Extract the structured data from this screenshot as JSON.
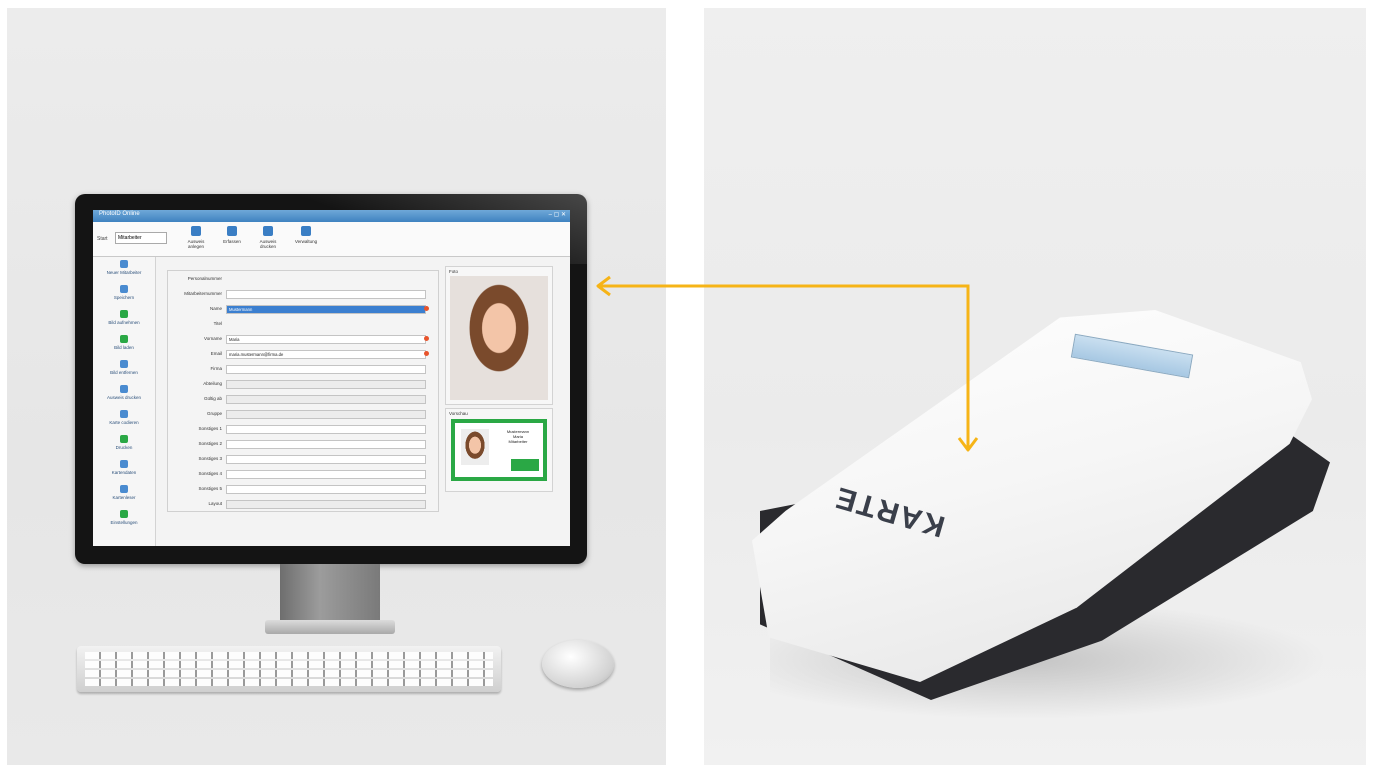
{
  "app": {
    "window_title": "PhotoID Online",
    "window_buttons": "– ▢ ✕",
    "ribbon": {
      "start_label": "Start",
      "dropdown_value": "Mitarbeiter",
      "buttons": [
        {
          "label": "Ausweis anlegen",
          "icon": "person-add-icon"
        },
        {
          "label": "Erfassen",
          "icon": "id-card-icon"
        },
        {
          "label": "Ausweis drucken",
          "icon": "print-icon"
        },
        {
          "label": "Verwaltung",
          "icon": "settings-icon"
        }
      ]
    },
    "sidebar": [
      {
        "label": "Neuer Mitarbeiter",
        "icon": "user-add-icon"
      },
      {
        "label": "Speichern",
        "icon": "save-icon"
      },
      {
        "label": "Bild aufnehmen",
        "icon": "camera-icon"
      },
      {
        "label": "Bild laden",
        "icon": "image-icon"
      },
      {
        "label": "Bild entfernen",
        "icon": "image-remove-icon"
      },
      {
        "label": "Ausweis drucken",
        "icon": "print-icon"
      },
      {
        "label": "Karte codieren",
        "icon": "card-icon"
      },
      {
        "label": "Drucken",
        "icon": "printer-icon"
      },
      {
        "label": "Kartendaten",
        "icon": "card-data-icon"
      },
      {
        "label": "Kartenleser",
        "icon": "reader-icon"
      },
      {
        "label": "Einstellungen",
        "icon": "settings-icon"
      }
    ],
    "form": {
      "fields": [
        {
          "label": "Personalnummer",
          "value": "",
          "required": false,
          "highlight": false
        },
        {
          "label": "Mitarbeiternummer",
          "value": "",
          "required": false,
          "highlight": false
        },
        {
          "label": "Name",
          "value": "Mustermann",
          "required": true,
          "highlight": true
        },
        {
          "label": "Titel",
          "value": "",
          "required": false,
          "highlight": false
        },
        {
          "label": "Vorname",
          "value": "Maria",
          "required": true,
          "highlight": false
        },
        {
          "label": "Email",
          "value": "maria.mustermann@firma.de",
          "required": true,
          "highlight": false
        },
        {
          "label": "Firma",
          "value": "",
          "required": false,
          "highlight": false
        },
        {
          "label": "Abteilung",
          "value": "",
          "required": false,
          "highlight": false
        },
        {
          "label": "Gültig ab",
          "value": "",
          "required": false,
          "highlight": false
        },
        {
          "label": "Gruppe",
          "value": "",
          "required": false,
          "highlight": false
        },
        {
          "label": "Sonstiges 1",
          "value": "",
          "required": false,
          "highlight": false
        },
        {
          "label": "Sonstiges 2",
          "value": "",
          "required": false,
          "highlight": false
        },
        {
          "label": "Sonstiges 3",
          "value": "",
          "required": false,
          "highlight": false
        },
        {
          "label": "Sonstiges 4",
          "value": "",
          "required": false,
          "highlight": false
        },
        {
          "label": "Sonstiges 5",
          "value": "",
          "required": false,
          "highlight": false
        },
        {
          "label": "Layout",
          "value": "",
          "required": false,
          "highlight": false
        }
      ]
    },
    "photo_panel_caption": "Foto",
    "card_panel_caption": "Vorschau",
    "card_preview": {
      "text_line1": "Mustermann",
      "text_line2": "Maria",
      "text_line3": "Mitarbeiter"
    }
  },
  "reader": {
    "logo": "KARTE"
  },
  "colors": {
    "arrow": "#f6b417",
    "card_green": "#2aa845",
    "window_blue": "#3f82c0",
    "required_red": "#e8542c"
  }
}
